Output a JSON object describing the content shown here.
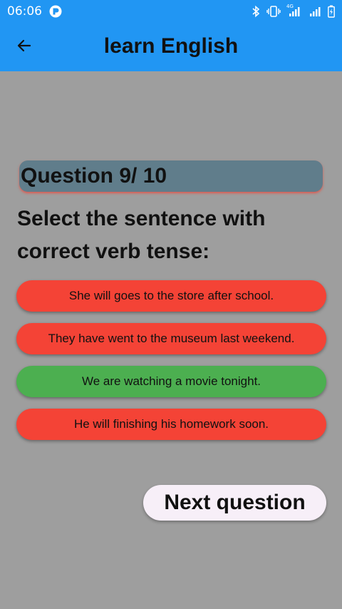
{
  "status_bar": {
    "time": "06:06",
    "network_label": "4G",
    "icons": [
      "app-notification-icon",
      "bluetooth-icon",
      "vibrate-icon",
      "signal-4g-icon",
      "signal-icon",
      "battery-charging-icon"
    ]
  },
  "app_bar": {
    "title": "learn English",
    "back_icon": "arrow-back-icon"
  },
  "quiz": {
    "progress_label": "Question 9/ 10",
    "current": 9,
    "total": 10,
    "prompt": "Select the sentence with correct verb tense:",
    "answers": [
      {
        "text": "She will goes to the store after school.",
        "state": "wrong"
      },
      {
        "text": "They have went to the museum last weekend.",
        "state": "wrong"
      },
      {
        "text": "We are watching a movie tonight.",
        "state": "correct"
      },
      {
        "text": "He will finishing his homework soon.",
        "state": "wrong"
      }
    ],
    "next_label": "Next question"
  },
  "colors": {
    "app_bar": "#2196f3",
    "background": "#9e9e9e",
    "question_header": "#607d8b",
    "wrong": "#f44336",
    "correct": "#4caf50",
    "next_button": "#f7eff8"
  }
}
